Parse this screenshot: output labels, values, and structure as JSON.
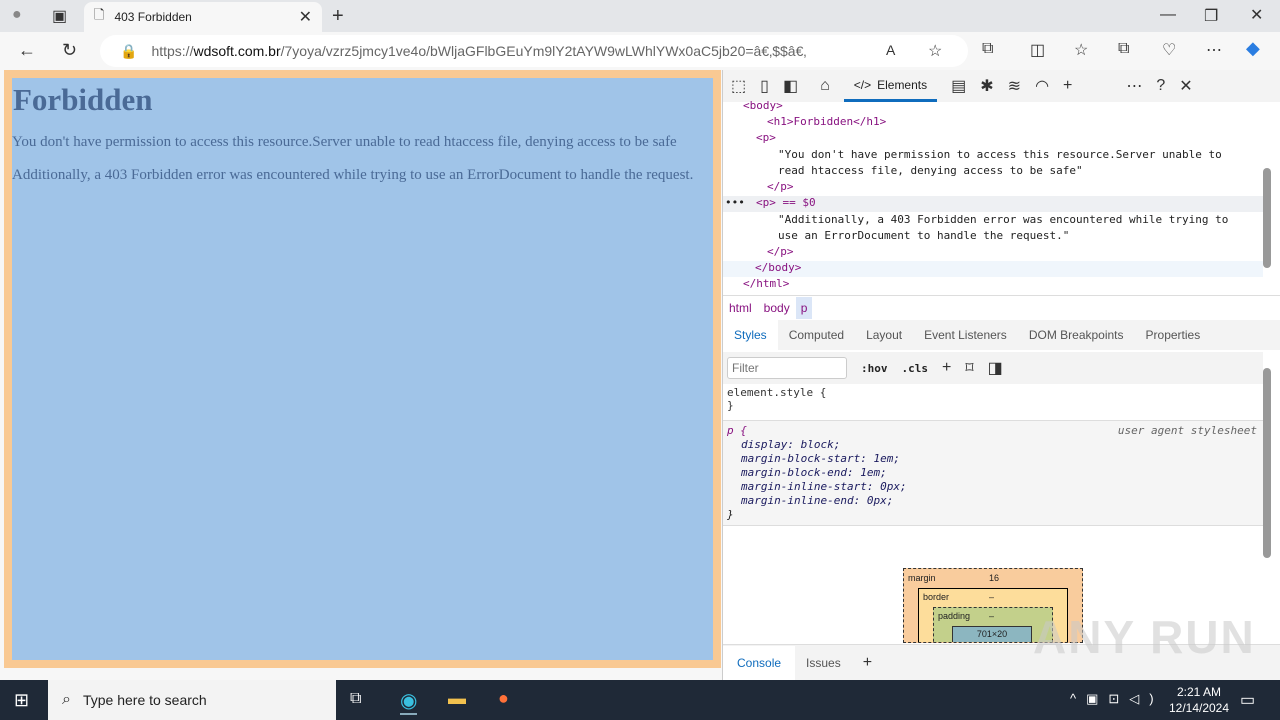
{
  "browser": {
    "tab_title": "403 Forbidden",
    "url_prefix": "https://",
    "url_domain": "wdsoft.com.br",
    "url_path": "/7yoya/vzrz5jmcy1ve4o/bWljaGFlbGEuYm9lY2tAYW9wLWhlYWx0aC5jb20=â€‚$$â€‚"
  },
  "page": {
    "heading": "Forbidden",
    "p1": "You don't have permission to access this resource.Server unable to read htaccess file, denying access to be safe",
    "p2": "Additionally, a 403 Forbidden error was encountered while trying to use an ErrorDocument to handle the request."
  },
  "devtools": {
    "active_tab": "Elements",
    "dom": {
      "body_open": "<body>",
      "h1": "<h1>Forbidden</h1>",
      "p_open": "<p>",
      "p1_line1": "\"You don't have permission to access this resource.Server unable to",
      "p1_line2": "read htaccess file, denying access to be safe\"",
      "p_close": "</p>",
      "p2_open": "<p> == $0",
      "p2_line1": "\"Additionally, a 403 Forbidden error was encountered while trying to",
      "p2_line2": "use an ErrorDocument to handle the request.\"",
      "body_close": "</body>",
      "html_close": "</html>"
    },
    "breadcrumbs": [
      "html",
      "body",
      "p"
    ],
    "panel_tabs": [
      "Styles",
      "Computed",
      "Layout",
      "Event Listeners",
      "DOM Breakpoints",
      "Properties"
    ],
    "filter_placeholder": "Filter",
    "hov": ":hov",
    "cls": ".cls",
    "element_style": "element.style {",
    "close_brace": "}",
    "rule_selector": "p {",
    "rule_source": "user agent stylesheet",
    "rule_props": [
      "display: block;",
      "margin-block-start: 1em;",
      "margin-block-end: 1em;",
      "margin-inline-start: 0px;",
      "margin-inline-end: 0px;"
    ],
    "boxmodel": {
      "margin_label": "margin",
      "margin_value": "16",
      "border_label": "border",
      "border_value": "–",
      "padding_label": "padding",
      "padding_value": "–",
      "content": "701×20"
    },
    "drawer_tabs": [
      "Console",
      "Issues"
    ]
  },
  "taskbar": {
    "search_placeholder": "Type here to search",
    "time": "2:21 AM",
    "date": "12/14/2024"
  },
  "watermark": "ANY RUN"
}
